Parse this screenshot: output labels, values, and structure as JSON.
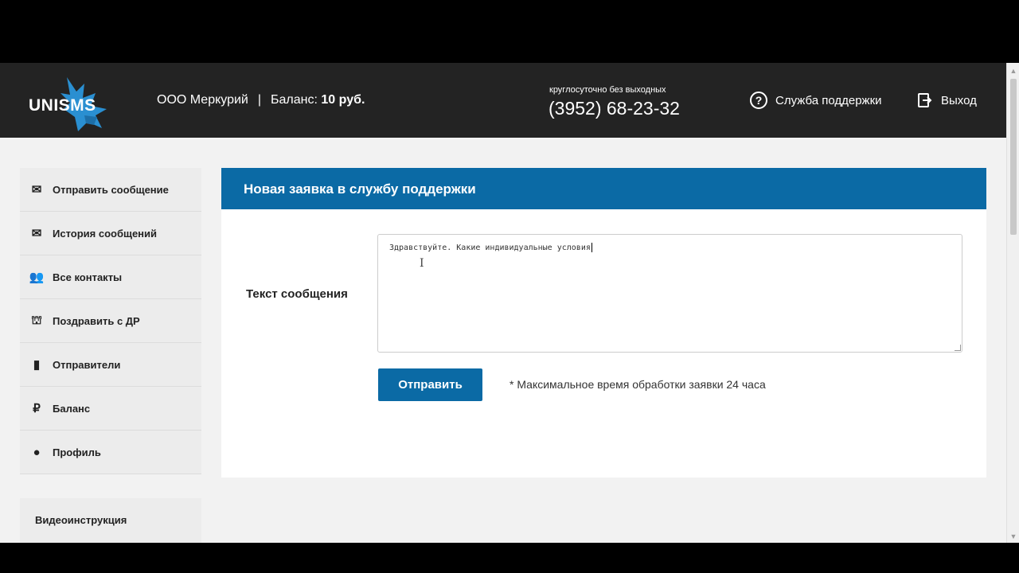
{
  "header": {
    "logo_text": "UNISMS",
    "company": "ООО Меркурий",
    "separator": "|",
    "balance_label": "Баланс:",
    "balance_value": "10 руб.",
    "phone_caption": "круглосуточно без выходных",
    "phone": "(3952) 68-23-32",
    "support_label": "Служба поддержки",
    "logout_label": "Выход"
  },
  "sidebar": {
    "items": [
      {
        "label": "Отправить сообщение",
        "icon": "envelope-send-icon"
      },
      {
        "label": "История сообщений",
        "icon": "envelope-history-icon"
      },
      {
        "label": "Все контакты",
        "icon": "contacts-icon"
      },
      {
        "label": "Поздравить с ДР",
        "icon": "birthday-cake-icon"
      },
      {
        "label": "Отправители",
        "icon": "senders-icon"
      },
      {
        "label": "Баланс",
        "icon": "ruble-icon"
      },
      {
        "label": "Профиль",
        "icon": "profile-icon"
      }
    ],
    "video_label": "Видеоинструкция"
  },
  "main": {
    "title": "Новая заявка в службу поддержки",
    "field_label": "Текст сообщения",
    "textarea_value": "Здравствуйте. Какие индивидуальные условия",
    "submit_label": "Отправить",
    "note": "* Максимальное время обработки заявки 24 часа"
  },
  "colors": {
    "header_bg": "#232323",
    "accent": "#0b6aa5",
    "logo_bird": "#2a8fd1"
  }
}
